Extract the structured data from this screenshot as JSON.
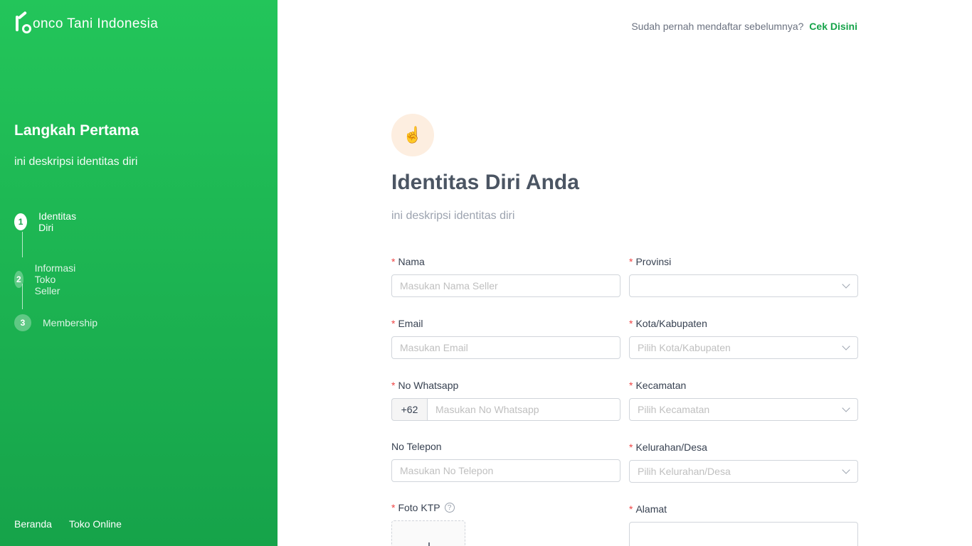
{
  "brand": {
    "name": "onco Tani Indonesia",
    "logo_letter": "K"
  },
  "sidebar": {
    "title": "Langkah Pertama",
    "description": "ini deskripsi identitas diri",
    "steps": [
      {
        "number": "1",
        "label": "Identitas Diri",
        "state": "active"
      },
      {
        "number": "2",
        "label": "Informasi Toko Seller",
        "state": "inactive"
      },
      {
        "number": "3",
        "label": "Membership",
        "state": "inactive"
      }
    ],
    "footer_links": [
      "Beranda",
      "Toko Online"
    ]
  },
  "header": {
    "prompt": "Sudah pernah mendaftar sebelumnya?",
    "link": "Cek Disini"
  },
  "main": {
    "icon": "pointing-hand-icon",
    "icon_glyph": "☝",
    "title": "Identitas Diri Anda",
    "description": "ini deskripsi identitas diri"
  },
  "form": {
    "required_mark": "*",
    "nama": {
      "label": "Nama",
      "placeholder": "Masukan Nama Seller"
    },
    "email": {
      "label": "Email",
      "placeholder": "Masukan Email"
    },
    "whatsapp": {
      "label": "No Whatsapp",
      "prefix": "+62",
      "placeholder": "Masukan No Whatsapp"
    },
    "telepon": {
      "label": "No Telepon",
      "placeholder": "Masukan No Telepon"
    },
    "foto_ktp": {
      "label": "Foto KTP",
      "help": "?"
    },
    "provinsi": {
      "label": "Provinsi",
      "placeholder": ""
    },
    "kota": {
      "label": "Kota/Kabupaten",
      "placeholder": "Pilih Kota/Kabupaten"
    },
    "kecamatan": {
      "label": "Kecamatan",
      "placeholder": "Pilih Kecamatan"
    },
    "kelurahan": {
      "label": "Kelurahan/Desa",
      "placeholder": "Pilih Kelurahan/Desa"
    },
    "alamat": {
      "label": "Alamat"
    }
  },
  "colors": {
    "primary": "#16a34a",
    "required": "#ef4444"
  }
}
